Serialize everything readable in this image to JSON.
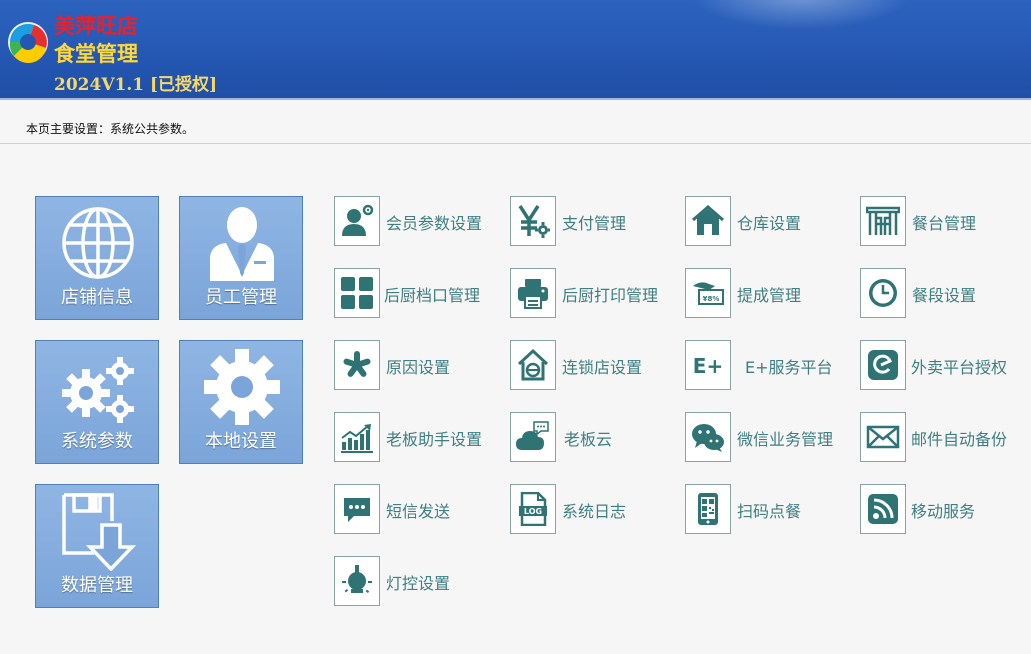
{
  "header": {
    "brand_name": "美萍旺店",
    "brand_sub": "食堂管理",
    "version": "2024V1.1 [已授权]"
  },
  "page": {
    "description": "本页主要设置：系统公共参数。"
  },
  "tiles": [
    {
      "label": "店铺信息",
      "icon": "globe-icon"
    },
    {
      "label": "员工管理",
      "icon": "employee-icon"
    },
    {
      "label": "系统参数",
      "icon": "gears-icon"
    },
    {
      "label": "本地设置",
      "icon": "gear-icon"
    },
    {
      "label": "数据管理",
      "icon": "save-download-icon"
    }
  ],
  "items": [
    {
      "label": "会员参数设置",
      "icon": "member-settings-icon"
    },
    {
      "label": "支付管理",
      "icon": "yuan-gear-icon"
    },
    {
      "label": "仓库设置",
      "icon": "warehouse-icon"
    },
    {
      "label": "餐台管理",
      "icon": "table-icon"
    },
    {
      "label": "后厨档口管理",
      "icon": "grid-icon"
    },
    {
      "label": "后厨打印管理",
      "icon": "printer-icon"
    },
    {
      "label": "提成管理",
      "icon": "commission-icon"
    },
    {
      "label": "餐段设置",
      "icon": "clock-icon"
    },
    {
      "label": "原因设置",
      "icon": "asterisk-icon"
    },
    {
      "label": "连锁店设置",
      "icon": "chain-store-icon"
    },
    {
      "label": "E+服务平台",
      "icon": "eplus-icon"
    },
    {
      "label": "外卖平台授权",
      "icon": "takeout-icon"
    },
    {
      "label": "老板助手设置",
      "icon": "chart-icon"
    },
    {
      "label": "老板云",
      "icon": "cloud-icon"
    },
    {
      "label": "微信业务管理",
      "icon": "wechat-icon"
    },
    {
      "label": "邮件自动备份",
      "icon": "mail-icon"
    },
    {
      "label": "短信发送",
      "icon": "sms-icon"
    },
    {
      "label": "系统日志",
      "icon": "log-icon"
    },
    {
      "label": "扫码点餐",
      "icon": "qr-phone-icon"
    },
    {
      "label": "移动服务",
      "icon": "rss-icon"
    },
    {
      "label": "灯控设置",
      "icon": "lamp-icon"
    }
  ],
  "colors": {
    "header_bg": "#2457b2",
    "brand_red": "#e8212b",
    "brand_yellow": "#ffd83a",
    "tile_bg": "#7ba5d9",
    "icon_teal": "#3f7f83"
  }
}
